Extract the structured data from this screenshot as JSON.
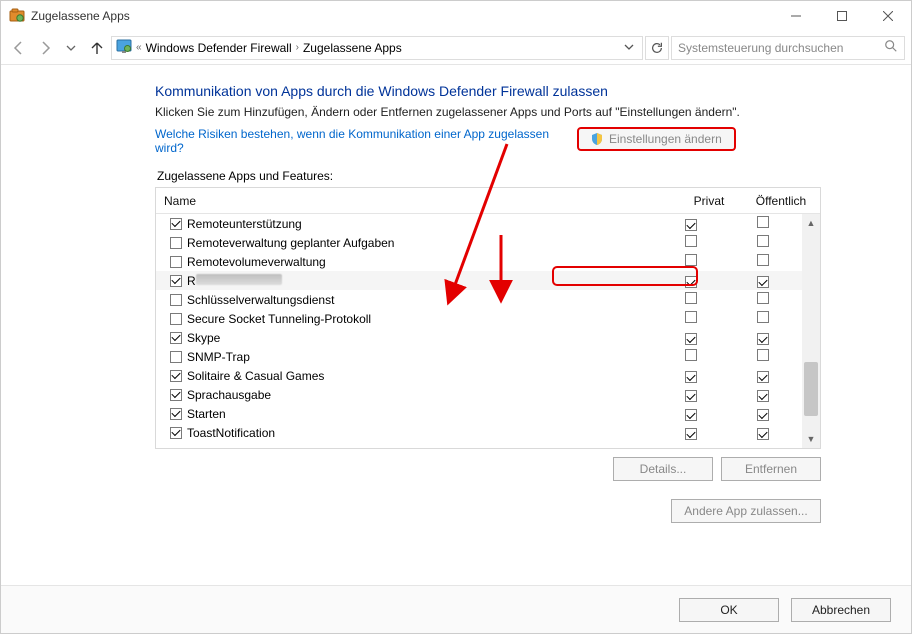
{
  "window": {
    "title": "Zugelassene Apps"
  },
  "breadcrumb": {
    "items": [
      "Windows Defender Firewall",
      "Zugelassene Apps"
    ]
  },
  "search": {
    "placeholder": "Systemsteuerung durchsuchen"
  },
  "page": {
    "heading": "Kommunikation von Apps durch die Windows Defender Firewall zulassen",
    "subtext": "Klicken Sie zum Hinzufügen, Ändern oder Entfernen zugelassener Apps und Ports auf \"Einstellungen ändern\".",
    "risk_link": "Welche Risiken bestehen, wenn die Kommunikation einer App zugelassen wird?",
    "change_settings_label": "Einstellungen ändern",
    "panel_title": "Zugelassene Apps und Features:",
    "columns": {
      "name": "Name",
      "private": "Privat",
      "public": "Öffentlich"
    },
    "details_label": "Details...",
    "remove_label": "Entfernen",
    "allow_another_label": "Andere App zulassen..."
  },
  "apps": [
    {
      "enabled": true,
      "name": "Remoteunterstützung",
      "private": true,
      "public": false
    },
    {
      "enabled": false,
      "name": "Remoteverwaltung geplanter Aufgaben",
      "private": false,
      "public": false
    },
    {
      "enabled": false,
      "name": "Remotevolumeverwaltung",
      "private": false,
      "public": false
    },
    {
      "enabled": true,
      "name": "R…",
      "private": true,
      "public": true,
      "highlight": true,
      "smudge": true
    },
    {
      "enabled": false,
      "name": "Schlüsselverwaltungsdienst",
      "private": false,
      "public": false
    },
    {
      "enabled": false,
      "name": "Secure Socket Tunneling-Protokoll",
      "private": false,
      "public": false
    },
    {
      "enabled": true,
      "name": "Skype",
      "private": true,
      "public": true
    },
    {
      "enabled": false,
      "name": "SNMP-Trap",
      "private": false,
      "public": false
    },
    {
      "enabled": true,
      "name": "Solitaire & Casual Games",
      "private": true,
      "public": true
    },
    {
      "enabled": true,
      "name": "Sprachausgabe",
      "private": true,
      "public": true
    },
    {
      "enabled": true,
      "name": "Starten",
      "private": true,
      "public": true
    },
    {
      "enabled": true,
      "name": "ToastNotification",
      "private": true,
      "public": true
    }
  ],
  "footer": {
    "ok": "OK",
    "cancel": "Abbrechen"
  }
}
